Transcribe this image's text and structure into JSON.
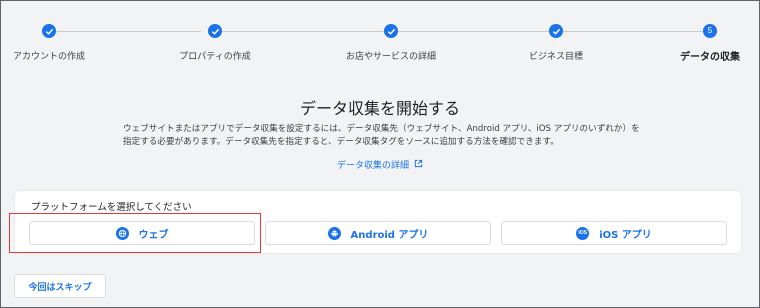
{
  "stepper": {
    "steps": [
      {
        "label": "アカウントの作成",
        "state": "done"
      },
      {
        "label": "プロパティの作成",
        "state": "done"
      },
      {
        "label": "お店やサービスの詳細",
        "state": "done"
      },
      {
        "label": "ビジネス目標",
        "state": "done"
      },
      {
        "label": "データの収集",
        "state": "current",
        "number": "5"
      }
    ]
  },
  "header": {
    "title": "データ収集を開始する",
    "description": "ウェブサイトまたはアプリでデータ収集を設定するには、データ収集先（ウェブサイト、Android アプリ、iOS アプリのいずれか）を指定する必要があります。データ収集先を指定すると、データ収集タグをソースに追加する方法を確認できます。",
    "detail_link": "データ収集の詳細"
  },
  "platform": {
    "title": "プラットフォームを選択してください",
    "options": [
      {
        "label": "ウェブ",
        "icon": "globe-icon"
      },
      {
        "label": "Android アプリ",
        "icon": "android-icon"
      },
      {
        "label": "iOS アプリ",
        "icon": "ios-icon",
        "icon_text": "iOS"
      }
    ]
  },
  "skip_label": "今回はスキップ",
  "colors": {
    "accent": "#1a73e8",
    "highlight": "#e53935",
    "background": "#f1f3f4"
  }
}
